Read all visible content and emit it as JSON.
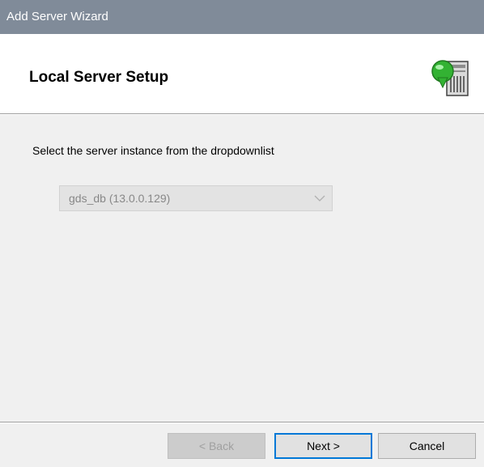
{
  "window": {
    "title": "Add Server Wizard"
  },
  "header": {
    "title": "Local Server Setup",
    "icon": "server-icon"
  },
  "main": {
    "prompt": "Select the server instance from the dropdownlist",
    "instance_select": {
      "selected": "gds_db (13.0.0.129)",
      "disabled": true
    }
  },
  "footer": {
    "back_label": "< Back",
    "next_label": "Next >",
    "cancel_label": "Cancel"
  },
  "colors": {
    "titlebar": "#808b99",
    "header_bg": "#ffffff",
    "dialog_bg": "#f0f0f0",
    "default_button_border": "#0078d7",
    "icon_green": "#33b233"
  }
}
